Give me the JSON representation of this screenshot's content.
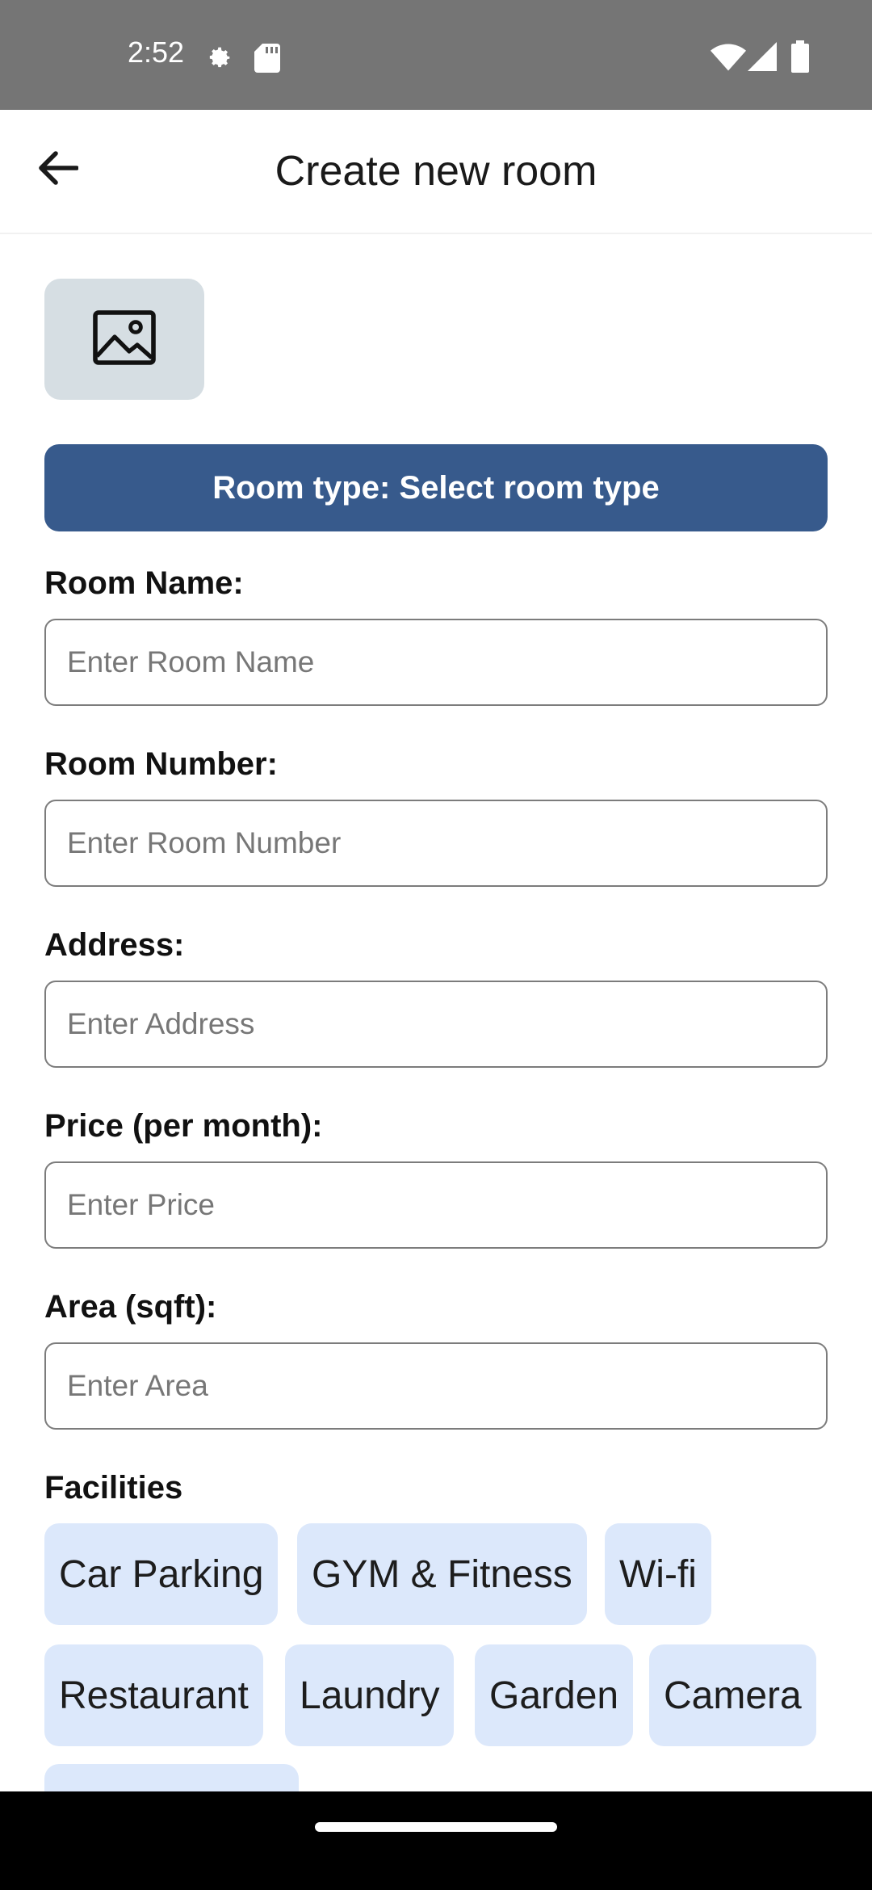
{
  "status_bar": {
    "time": "2:52",
    "icons": [
      "settings-icon",
      "sd-card-icon",
      "wifi-icon",
      "signal-icon",
      "battery-icon"
    ]
  },
  "app_bar": {
    "back_icon": "arrow-left-icon",
    "title": "Create new room"
  },
  "image_picker": {
    "icon": "image-icon"
  },
  "room_type_button": {
    "label": "Room type: Select room type",
    "color": "#375a8c"
  },
  "form": {
    "room_name": {
      "label": "Room Name:",
      "placeholder": "Enter Room Name",
      "value": ""
    },
    "room_number": {
      "label": "Room Number:",
      "placeholder": "Enter Room Number",
      "value": ""
    },
    "address": {
      "label": "Address:",
      "placeholder": "Enter Address",
      "value": ""
    },
    "price": {
      "label": "Price (per month):",
      "placeholder": "Enter Price",
      "value": ""
    },
    "area": {
      "label": "Area (sqft):",
      "placeholder": "Enter Area",
      "value": ""
    }
  },
  "facilities": {
    "heading": "Facilities",
    "chip_color": "#dce8fb",
    "items": [
      "Car Parking",
      "GYM & Fitness",
      "Wi-fi",
      "Restaurant",
      "Laundry",
      "Garden",
      "Camera"
    ]
  }
}
